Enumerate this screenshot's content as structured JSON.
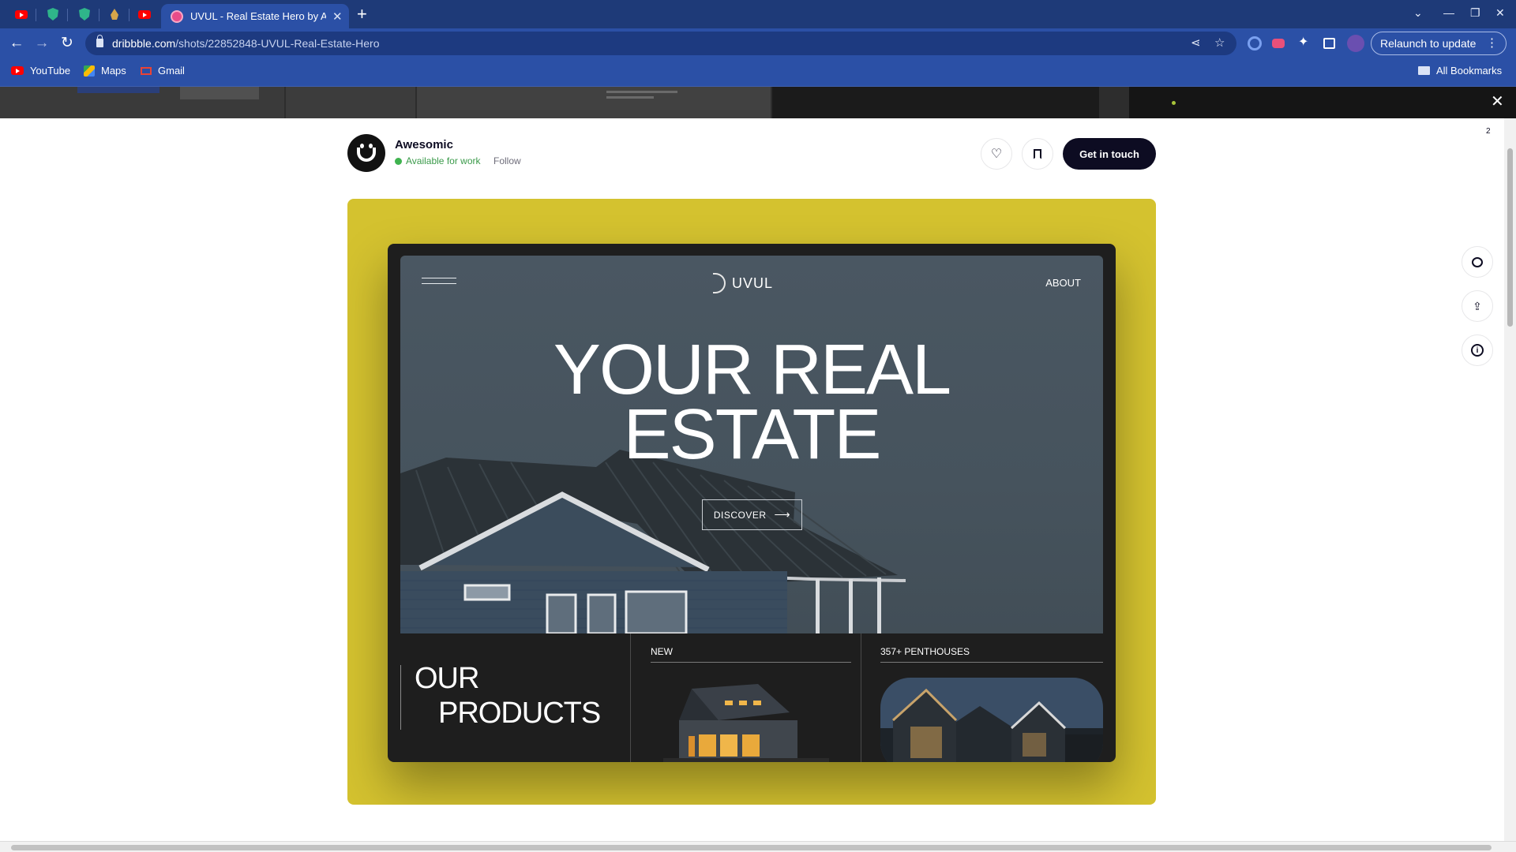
{
  "browser": {
    "active_tab_title": "UVUL - Real Estate Hero by Aw",
    "url_host": "dribbble.com",
    "url_path": "/shots/22852848-UVUL-Real-Estate-Hero",
    "relaunch_label": "Relaunch to update",
    "new_tab_symbol": "+",
    "bookmarks": [
      {
        "label": "YouTube",
        "icon": "youtube-icon"
      },
      {
        "label": "Maps",
        "icon": "maps-icon"
      },
      {
        "label": "Gmail",
        "icon": "gmail-icon"
      }
    ],
    "all_bookmarks_label": "All Bookmarks",
    "colors": {
      "frame": "#1e3a78",
      "toolbar": "#2b50a6"
    }
  },
  "shot_header": {
    "author_name": "Awesomic",
    "availability": "Available for work",
    "follow_label": "Follow",
    "cta_label": "Get in touch",
    "comment_count": "2"
  },
  "shot": {
    "background_color": "#d4c22f",
    "brand": "UVUL",
    "nav_about": "ABOUT",
    "headline_line1": "YOUR REAL",
    "headline_line2": "ESTATE",
    "discover_label": "DISCOVER",
    "products_line1": "OUR",
    "products_line2": "PRODUCTS",
    "product_new_label": "NEW",
    "product_penthouses_label": "357+ PENTHOUSES"
  }
}
